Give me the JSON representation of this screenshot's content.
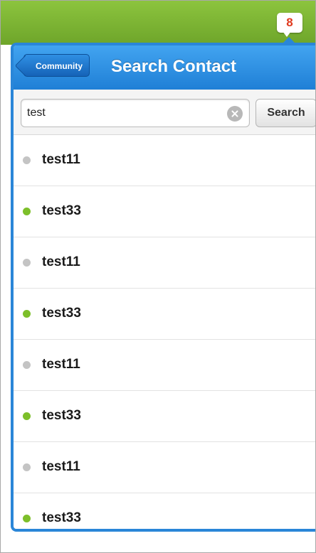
{
  "notifications": {
    "count": "8"
  },
  "header": {
    "back_label": "Community",
    "title": "Search Contact"
  },
  "search": {
    "value": "test",
    "button_label": "Search"
  },
  "colors": {
    "online": "#7dbf2a",
    "offline": "#c4c4c4",
    "topbar": "#7ab533",
    "header": "#2a86d8",
    "badge_text": "#e03a1e"
  },
  "contacts": [
    {
      "name": "test11",
      "status": "offline"
    },
    {
      "name": "test33",
      "status": "online"
    },
    {
      "name": "test11",
      "status": "offline"
    },
    {
      "name": "test33",
      "status": "online"
    },
    {
      "name": "test11",
      "status": "offline"
    },
    {
      "name": "test33",
      "status": "online"
    },
    {
      "name": "test11",
      "status": "offline"
    },
    {
      "name": "test33",
      "status": "online"
    }
  ]
}
